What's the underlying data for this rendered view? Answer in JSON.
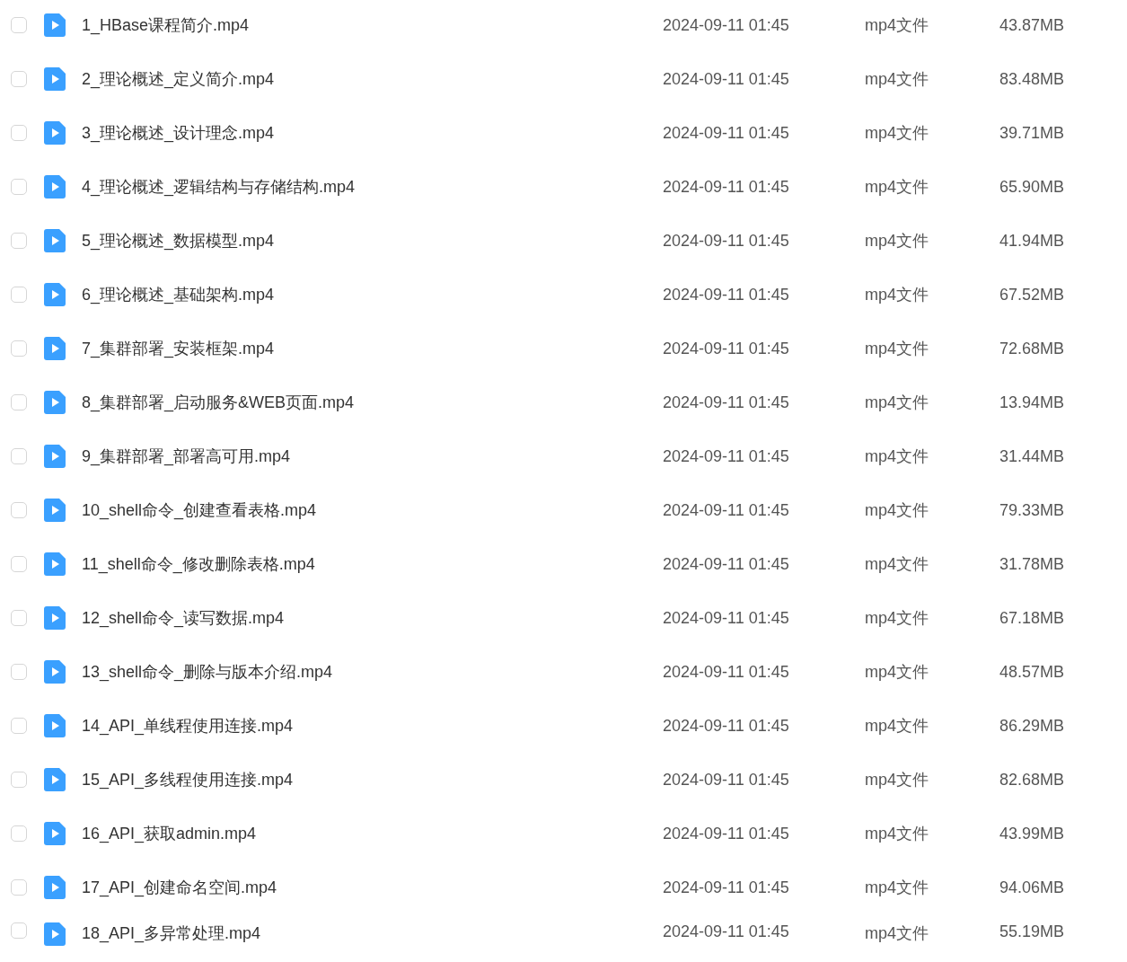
{
  "files": [
    {
      "name": "1_HBase课程简介.mp4",
      "modified": "2024-09-11 01:45",
      "type": "mp4文件",
      "size": "43.87MB",
      "checked": false
    },
    {
      "name": "2_理论概述_定义简介.mp4",
      "modified": "2024-09-11 01:45",
      "type": "mp4文件",
      "size": "83.48MB",
      "checked": false
    },
    {
      "name": "3_理论概述_设计理念.mp4",
      "modified": "2024-09-11 01:45",
      "type": "mp4文件",
      "size": "39.71MB",
      "checked": false
    },
    {
      "name": "4_理论概述_逻辑结构与存储结构.mp4",
      "modified": "2024-09-11 01:45",
      "type": "mp4文件",
      "size": "65.90MB",
      "checked": false
    },
    {
      "name": "5_理论概述_数据模型.mp4",
      "modified": "2024-09-11 01:45",
      "type": "mp4文件",
      "size": "41.94MB",
      "checked": false
    },
    {
      "name": "6_理论概述_基础架构.mp4",
      "modified": "2024-09-11 01:45",
      "type": "mp4文件",
      "size": "67.52MB",
      "checked": false
    },
    {
      "name": "7_集群部署_安装框架.mp4",
      "modified": "2024-09-11 01:45",
      "type": "mp4文件",
      "size": "72.68MB",
      "checked": false
    },
    {
      "name": "8_集群部署_启动服务&WEB页面.mp4",
      "modified": "2024-09-11 01:45",
      "type": "mp4文件",
      "size": "13.94MB",
      "checked": false
    },
    {
      "name": "9_集群部署_部署高可用.mp4",
      "modified": "2024-09-11 01:45",
      "type": "mp4文件",
      "size": "31.44MB",
      "checked": false
    },
    {
      "name": "10_shell命令_创建查看表格.mp4",
      "modified": "2024-09-11 01:45",
      "type": "mp4文件",
      "size": "79.33MB",
      "checked": false
    },
    {
      "name": "11_shell命令_修改删除表格.mp4",
      "modified": "2024-09-11 01:45",
      "type": "mp4文件",
      "size": "31.78MB",
      "checked": false
    },
    {
      "name": "12_shell命令_读写数据.mp4",
      "modified": "2024-09-11 01:45",
      "type": "mp4文件",
      "size": "67.18MB",
      "checked": false
    },
    {
      "name": "13_shell命令_删除与版本介绍.mp4",
      "modified": "2024-09-11 01:45",
      "type": "mp4文件",
      "size": "48.57MB",
      "checked": false
    },
    {
      "name": "14_API_单线程使用连接.mp4",
      "modified": "2024-09-11 01:45",
      "type": "mp4文件",
      "size": "86.29MB",
      "checked": false
    },
    {
      "name": "15_API_多线程使用连接.mp4",
      "modified": "2024-09-11 01:45",
      "type": "mp4文件",
      "size": "82.68MB",
      "checked": false
    },
    {
      "name": "16_API_获取admin.mp4",
      "modified": "2024-09-11 01:45",
      "type": "mp4文件",
      "size": "43.99MB",
      "checked": false
    },
    {
      "name": "17_API_创建命名空间.mp4",
      "modified": "2024-09-11 01:45",
      "type": "mp4文件",
      "size": "94.06MB",
      "checked": false
    },
    {
      "name": "18_API_多异常处理.mp4",
      "modified": "2024-09-11 01:45",
      "type": "mp4文件",
      "size": "55.19MB",
      "checked": false
    }
  ]
}
